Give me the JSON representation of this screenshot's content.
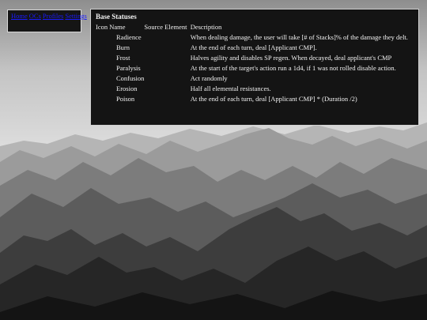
{
  "nav": {
    "links": [
      "Home",
      "OCs",
      "Profiles",
      "Settings"
    ]
  },
  "panel": {
    "title": "Base Statuses",
    "headers": {
      "icon": "Icon",
      "name": "Name",
      "source": "Source Element",
      "description": "Description"
    },
    "rows": [
      {
        "name": "Radience",
        "source": "",
        "description": "When dealing damage, the user will take [# of Stacks]% of the damage they delt."
      },
      {
        "name": "Burn",
        "source": "",
        "description": "At the end of each turn, deal [Applicant CMP]."
      },
      {
        "name": "Frost",
        "source": "",
        "description": "Halves agility and disables SP regen. When decayed, deal applicant's CMP"
      },
      {
        "name": "Paralysis",
        "source": "",
        "description": "At the start of the target's action run a 1d4, if 1 was not rolled disable action."
      },
      {
        "name": "Confusion",
        "source": "",
        "description": "Act randomly"
      },
      {
        "name": "Erosion",
        "source": "",
        "description": "Half all elemental resistances."
      },
      {
        "name": "Poison",
        "source": "",
        "description": "At the end of each turn, deal [Applicant CMP] * (Duration /2)"
      }
    ]
  },
  "colors": {
    "panel_bg": "#141414",
    "link": "#1a1aff",
    "text": "#f2f2f2"
  }
}
